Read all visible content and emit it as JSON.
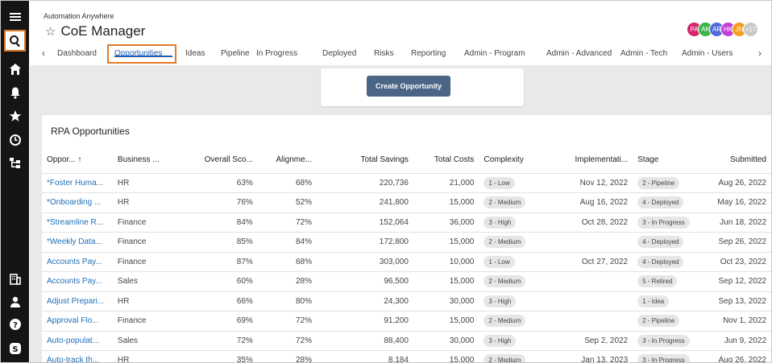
{
  "app": {
    "brand": "Automation Anywhere",
    "title": "CoE Manager"
  },
  "rail": {
    "icons": [
      "menu-icon",
      "search-icon",
      "home-icon",
      "bell-icon",
      "star-icon",
      "clock-icon",
      "network-icon",
      "building-icon",
      "user-icon",
      "help-icon",
      "brand-icon"
    ]
  },
  "avatars": [
    {
      "initials": "PA",
      "color": "#d6256b"
    },
    {
      "initials": "AK",
      "color": "#3bb54a"
    },
    {
      "initials": "AR",
      "color": "#4f6bd8"
    },
    {
      "initials": "HK",
      "color": "#c43dd6"
    },
    {
      "initials": "JN",
      "color": "#f0a020"
    },
    {
      "initials": "+17",
      "color": "#c9c9c9"
    }
  ],
  "tabs": [
    "Dashboard",
    "Opportunities",
    "Ideas",
    "Pipeline",
    "In Progress",
    "Deployed",
    "Risks",
    "Reporting",
    "Admin - Program",
    "Admin - Advanced",
    "Admin - Tech",
    "Admin - Users"
  ],
  "active_tab": "Opportunities",
  "create_button": "Create Opportunity",
  "table": {
    "title": "RPA Opportunities",
    "columns": [
      "Oppor... ↑",
      "Business ...",
      "Overall Sco...",
      "Alignme...",
      "Total Savings",
      "Total Costs",
      "Complexity",
      "Implementati...",
      "Stage",
      "Submitted"
    ],
    "rows": [
      [
        "*Foster Huma...",
        "HR",
        "63%",
        "68%",
        "220,736",
        "21,000",
        "1 - Low",
        "Nov 12, 2022",
        "2 - Pipeline",
        "Aug 26, 2022"
      ],
      [
        "*Onboarding ...",
        "HR",
        "76%",
        "52%",
        "241,800",
        "15,000",
        "2 - Medium",
        "Aug 16, 2022",
        "4 - Deployed",
        "May 16, 2022"
      ],
      [
        "*Streamline R...",
        "Finance",
        "84%",
        "72%",
        "152,064",
        "36,000",
        "3 - High",
        "Oct 28, 2022",
        "3 - In Progress",
        "Jun 18, 2022"
      ],
      [
        "*Weekly Data...",
        "Finance",
        "85%",
        "84%",
        "172,800",
        "15,000",
        "2 - Medium",
        "",
        "4 - Deployed",
        "Sep 26, 2022"
      ],
      [
        "Accounts Pay...",
        "Finance",
        "87%",
        "68%",
        "303,000",
        "10,000",
        "1 - Low",
        "Oct 27, 2022",
        "4 - Deployed",
        "Oct 23, 2022"
      ],
      [
        "Accounts Pay...",
        "Sales",
        "60%",
        "28%",
        "96,500",
        "15,000",
        "2 - Medium",
        "",
        "5 - Retired",
        "Sep 12, 2022"
      ],
      [
        "Adjust Prepari...",
        "HR",
        "66%",
        "80%",
        "24,300",
        "30,000",
        "3 - High",
        "",
        "1 - Idea",
        "Sep 13, 2022"
      ],
      [
        "Approval Flo...",
        "Finance",
        "69%",
        "72%",
        "91,200",
        "15,000",
        "2 - Medium",
        "",
        "2 - Pipeline",
        "Nov 1, 2022"
      ],
      [
        "Auto-populat...",
        "Sales",
        "72%",
        "72%",
        "88,400",
        "30,000",
        "3 - High",
        "Sep 2, 2022",
        "3 - In Progress",
        "Jun 9, 2022"
      ],
      [
        "Auto-track th...",
        "HR",
        "35%",
        "28%",
        "8,184",
        "15,000",
        "2 - Medium",
        "Jan 13, 2023",
        "3 - In Progress",
        "Aug 26, 2022"
      ]
    ]
  }
}
